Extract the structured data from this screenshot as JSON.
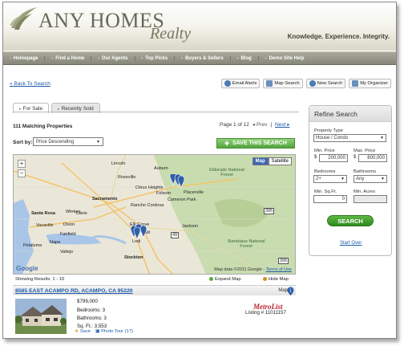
{
  "header": {
    "logo_main": "ANY HOMES",
    "logo_sub": "Realty",
    "tagline": "Knowledge. Experience. Integrity."
  },
  "nav": {
    "items": [
      "Homepage",
      "Find a Home",
      "Our Agents",
      "Top Picks",
      "Buyers & Sellers",
      "Blog",
      "Demo Site Help"
    ]
  },
  "toolbar": {
    "back": "Back To Search",
    "email_alerts": "Email Alerts",
    "map_search": "Map Search",
    "new_search": "New Search",
    "my_organizer": "My Organizer"
  },
  "tabs": [
    "For Sale",
    "Recently Sold"
  ],
  "results": {
    "matching": "111 Matching Properties",
    "page_info": "Page 1 of 12",
    "prev": "Prev",
    "separator": "|",
    "next": "Next",
    "sort_label": "Sort by:",
    "sort_value": "Price Descending",
    "save_search": "SAVE THIS SEARCH",
    "showing": "Showing Results: 1 - 10",
    "expand_map": "Expand Map",
    "hide_map": "Hide Map"
  },
  "map": {
    "btn_map": "Map",
    "btn_satellite": "Satellite",
    "copyright": "Map data ©2011 Google",
    "terms": "Terms of Use",
    "google": "Google",
    "towns": [
      "Lincoln",
      "Roseville",
      "Auburn",
      "Citrus Heights",
      "Folsom",
      "Sacramento",
      "Rancho Cordova",
      "Placerville",
      "Eldorado National Forest",
      "Davis",
      "Elk Grove",
      "Vacaville",
      "Fairfield",
      "Santa Rosa",
      "Napa",
      "Petaluma",
      "Vallejo",
      "Lodi",
      "Stockton",
      "Stanislaus National Forest",
      "Cameron Park",
      "Dixon",
      "Winters",
      "Galt",
      "Jackson"
    ],
    "route_labels": [
      "395",
      "49",
      "395"
    ]
  },
  "listing": {
    "address": "8585 EAST ACAMPO RD, ACAMPO, CA 95220",
    "map_label": "Map",
    "pin_number": "1",
    "price": "$799,000",
    "bedrooms": "Bedrooms: 3",
    "bathrooms": "Bathrooms: 3",
    "sqft": "Sq. Ft.: 3,553",
    "save": "Save",
    "photo_tour": "Photo Tour (17)",
    "mls_logo": "MetroList",
    "listing_number": "Listing # 11011157"
  },
  "refine": {
    "title": "Refine Search",
    "property_type_label": "Property Type",
    "property_type_value": "House / Condo",
    "min_price_label": "Min. Price",
    "max_price_label": "Max. Price",
    "min_price_value": "200,000",
    "max_price_value": "800,000",
    "currency": "$",
    "bedrooms_label": "Bedrooms",
    "bedrooms_value": "2+",
    "bathrooms_label": "Bathrooms",
    "bathrooms_value": "Any",
    "min_sqft_label": "Min. Sq.Ft.",
    "min_sqft_value": "0",
    "min_acres_label": "Min. Acres",
    "min_acres_value": "",
    "search_btn": "SEARCH",
    "start_over": "Start Over"
  },
  "colors": {
    "nav_bg": "#94958a",
    "link": "#1a5aa8",
    "accent_green": "#55a43c",
    "map_land": "#eeeadf",
    "map_forest": "#c9dcb0"
  }
}
